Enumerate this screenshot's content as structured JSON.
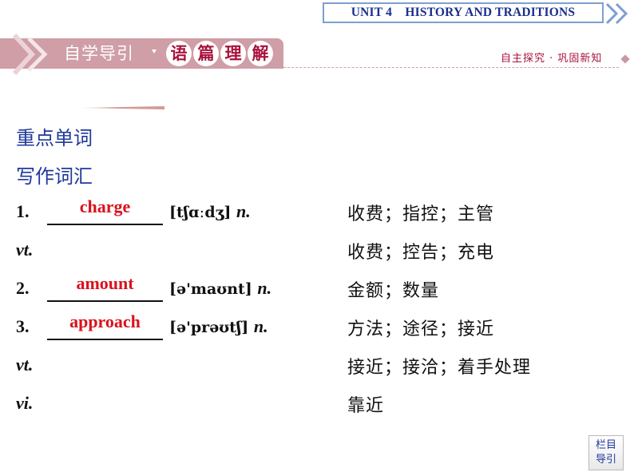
{
  "header": {
    "unit_title": "UNIT 4    HISTORY AND TRADITIONS",
    "section_label": "自学导引",
    "section_subtitle_chars": [
      "语",
      "篇",
      "理",
      "解"
    ],
    "right_label": "自主探究 · 巩固新知"
  },
  "content": {
    "heading_1": "重点单词",
    "heading_2": "写作词汇",
    "items": [
      {
        "number": "1.",
        "answer": "charge",
        "phonetic": "[tʃɑːdʒ]",
        "pos": "n.",
        "meaning": "收费；指控；主管"
      },
      {
        "pos_only": "vt.",
        "meaning": "收费；控告；充电"
      },
      {
        "number": "2.",
        "answer": "amount",
        "phonetic": "[ə'maʊnt]",
        "pos": "n.",
        "meaning": "金额；数量"
      },
      {
        "number": "3.",
        "answer": "approach",
        "phonetic": "[ə'prəʊtʃ]",
        "pos": "n.",
        "meaning": "方法；途径；接近"
      },
      {
        "pos_only": "vt.",
        "meaning": "接近；接洽；着手处理"
      },
      {
        "pos_only": "vi.",
        "meaning": "靠近"
      }
    ]
  },
  "nav": {
    "line1": "栏目",
    "line2": "导引"
  },
  "colors": {
    "answer_red": "#d8131d",
    "heading_blue": "#1f3a9a",
    "section_pink": "#cf9ea6",
    "accent_crimson": "#a8123d"
  }
}
